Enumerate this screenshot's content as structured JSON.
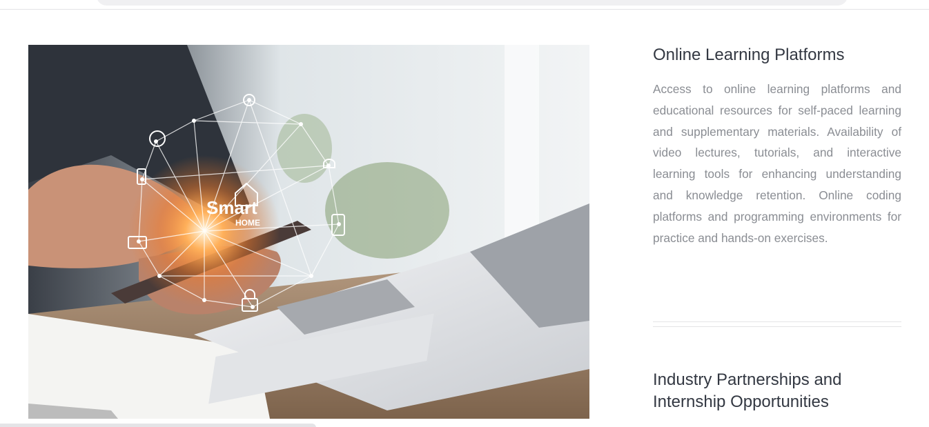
{
  "sections": [
    {
      "title": "Online Learning Platforms",
      "text": "Access to online learning platforms and educational resources for self-paced learning and supplementary materials. Availability of video lectures, tutorials, and interactive learning tools for enhancing understanding and knowledge retention. Online coding platforms and programming environments for practice and hands-on exercises."
    },
    {
      "title": "Industry Partnerships and Internship Opportunities"
    }
  ],
  "image": {
    "smart_label": "Smart",
    "home_label": "HOME"
  },
  "colors": {
    "title": "#333842",
    "body_text": "#8a8d93",
    "divider": "#e4e4e6"
  }
}
